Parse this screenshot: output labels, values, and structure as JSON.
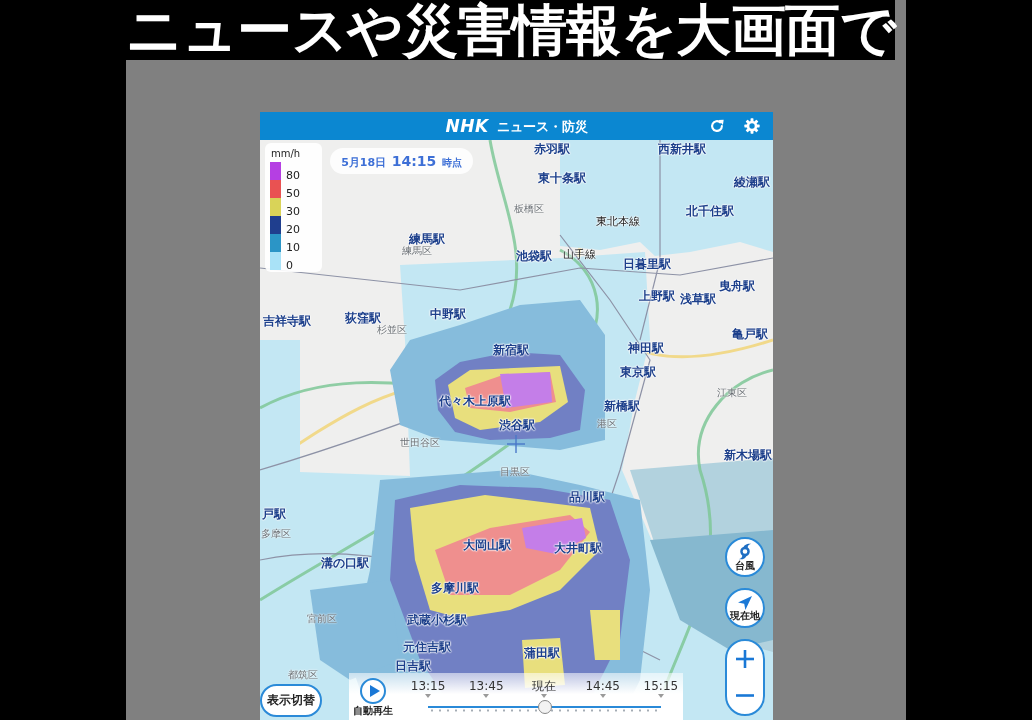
{
  "headline": "ニュースや災害情報を大画面で",
  "app": {
    "logo": "NHK",
    "title": "ニュース・防災"
  },
  "legend": {
    "unit": "mm/h",
    "items": [
      {
        "label": "80",
        "color": "#b53fe3"
      },
      {
        "label": "50",
        "color": "#e95252"
      },
      {
        "label": "30",
        "color": "#d9d358"
      },
      {
        "label": "20",
        "color": "#1f3e8e"
      },
      {
        "label": "10",
        "color": "#2b95c6"
      },
      {
        "label": "0",
        "color": "#a9e2f7"
      }
    ]
  },
  "timestamp": {
    "date": "5月18日",
    "time": "14:15",
    "suffix": "時点"
  },
  "map_labels": [
    {
      "text": "赤羽駅",
      "kind": "station"
    },
    {
      "text": "西新井駅",
      "kind": "station"
    },
    {
      "text": "東十条駅",
      "kind": "station"
    },
    {
      "text": "綾瀬駅",
      "kind": "station"
    },
    {
      "text": "板橋区",
      "kind": "ward"
    },
    {
      "text": "北千住駅",
      "kind": "station"
    },
    {
      "text": "東北本線",
      "kind": "line"
    },
    {
      "text": "練馬駅",
      "kind": "station"
    },
    {
      "text": "練馬区",
      "kind": "ward"
    },
    {
      "text": "池袋駅",
      "kind": "station"
    },
    {
      "text": "山手線",
      "kind": "line"
    },
    {
      "text": "日暮里駅",
      "kind": "station"
    },
    {
      "text": "曳舟駅",
      "kind": "station"
    },
    {
      "text": "上野駅",
      "kind": "station"
    },
    {
      "text": "浅草駅",
      "kind": "station"
    },
    {
      "text": "吉祥寺駅",
      "kind": "station"
    },
    {
      "text": "荻窪駅",
      "kind": "station"
    },
    {
      "text": "中野駅",
      "kind": "station"
    },
    {
      "text": "杉並区",
      "kind": "ward"
    },
    {
      "text": "亀戸駅",
      "kind": "station"
    },
    {
      "text": "神田駅",
      "kind": "station"
    },
    {
      "text": "新宿駅",
      "kind": "station"
    },
    {
      "text": "東京駅",
      "kind": "station"
    },
    {
      "text": "江東区",
      "kind": "ward"
    },
    {
      "text": "代々木上原駅",
      "kind": "station"
    },
    {
      "text": "新橋駅",
      "kind": "station"
    },
    {
      "text": "港区",
      "kind": "ward"
    },
    {
      "text": "渋谷駅",
      "kind": "station"
    },
    {
      "text": "世田谷区",
      "kind": "ward"
    },
    {
      "text": "新木場駅",
      "kind": "station"
    },
    {
      "text": "目黒区",
      "kind": "ward"
    },
    {
      "text": "品川駅",
      "kind": "station"
    },
    {
      "text": "戸駅",
      "kind": "station"
    },
    {
      "text": "多摩区",
      "kind": "ward"
    },
    {
      "text": "大岡山駅",
      "kind": "station"
    },
    {
      "text": "大井町駅",
      "kind": "station"
    },
    {
      "text": "溝の口駅",
      "kind": "station"
    },
    {
      "text": "多摩川駅",
      "kind": "station"
    },
    {
      "text": "宮前区",
      "kind": "ward"
    },
    {
      "text": "武蔵小杉駅",
      "kind": "station"
    },
    {
      "text": "元住吉駅",
      "kind": "station"
    },
    {
      "text": "蒲田駅",
      "kind": "station"
    },
    {
      "text": "日吉駅",
      "kind": "station"
    },
    {
      "text": "都筑区",
      "kind": "ward"
    }
  ],
  "side_buttons": [
    {
      "kind": "typhoon",
      "label": "台風"
    },
    {
      "kind": "location",
      "label": "現在地"
    }
  ],
  "view_toggle": {
    "label": "表示切替"
  },
  "playback": {
    "label": "自動再生",
    "times": [
      "13:15",
      "13:45",
      "現在",
      "14:45",
      "15:15"
    ],
    "level": 0.5
  }
}
